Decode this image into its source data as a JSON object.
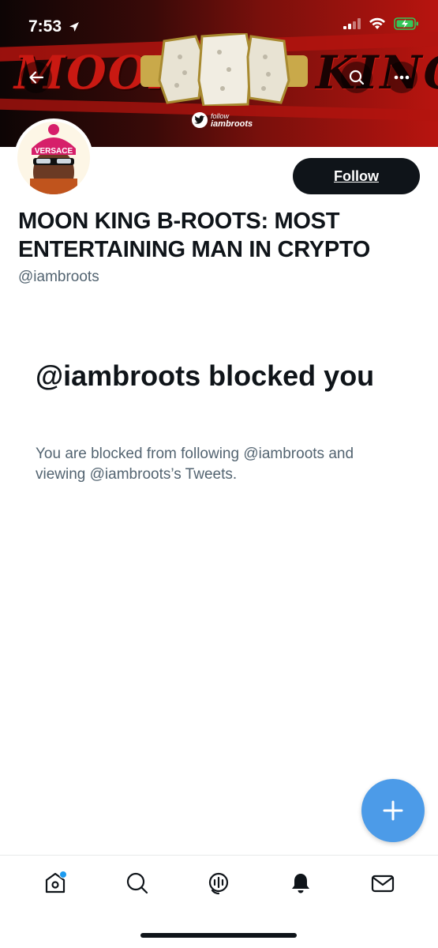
{
  "status_bar": {
    "time": "7:53"
  },
  "banner": {
    "word_left": "MOON",
    "word_right": "KING",
    "follow_tag": {
      "small": "follow",
      "handle": "iambroots"
    }
  },
  "profile": {
    "name": "MOON KING B-ROOTS: MOST ENTERTAINING MAN IN CRYPTO",
    "handle": "@iambroots",
    "avatar_hat_text": "VERSACE",
    "follow_label": "Follow"
  },
  "blocked": {
    "title": "@iambroots blocked you",
    "description": "You are blocked from following @iambroots and viewing @iambroots’s Tweets."
  },
  "colors": {
    "accent": "#1d9bf0",
    "fab": "#4c9be8",
    "text_primary": "#0f1419",
    "text_secondary": "#536471",
    "banner_red": "#b8140f",
    "battery_green": "#34c759"
  },
  "tabbar": {
    "items": [
      {
        "icon": "home-icon",
        "has_notification_dot": true
      },
      {
        "icon": "search-icon",
        "has_notification_dot": false
      },
      {
        "icon": "spaces-icon",
        "has_notification_dot": false
      },
      {
        "icon": "notifications-icon",
        "has_notification_dot": false
      },
      {
        "icon": "messages-icon",
        "has_notification_dot": false
      }
    ]
  }
}
